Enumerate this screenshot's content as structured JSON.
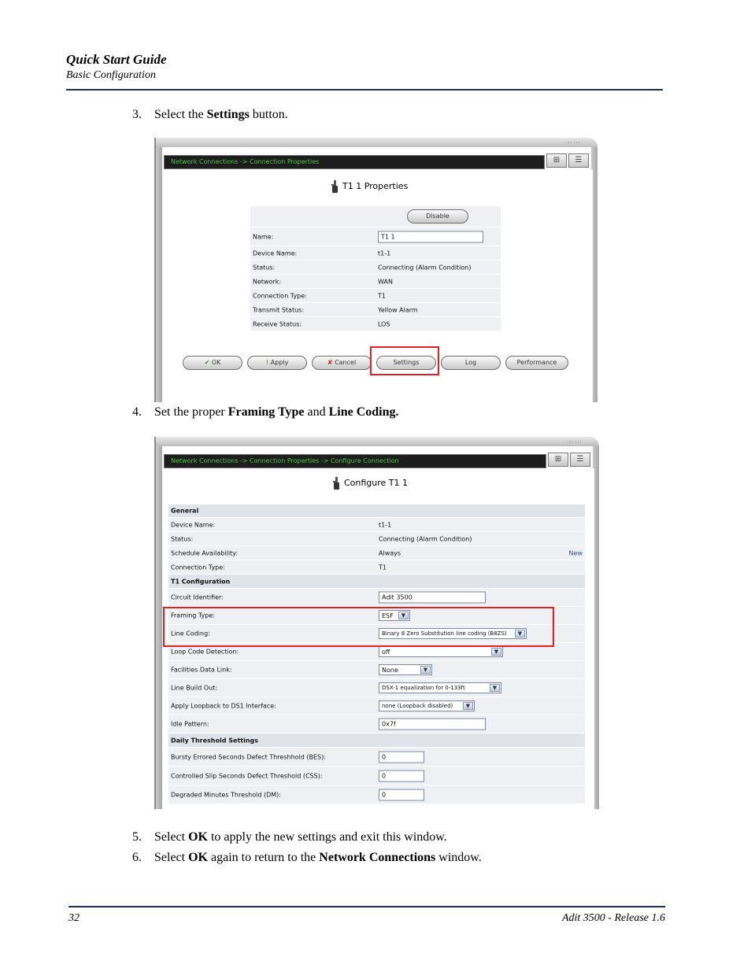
{
  "header": {
    "title": "Quick Start Guide",
    "subtitle": "Basic Configuration"
  },
  "steps": {
    "s3": {
      "num": "3.",
      "pre": "Select the ",
      "bold": "Settings",
      "post": " button."
    },
    "s4": {
      "num": "4.",
      "pre": "Set the proper ",
      "bold1": "Framing Type",
      "mid": " and ",
      "bold2": "Line Coding."
    },
    "s5": {
      "num": "5.",
      "pre": "Select ",
      "bold": "OK",
      "post": " to apply the new settings and exit this window."
    },
    "s6": {
      "num": "6.",
      "pre": "Select ",
      "bold1": "OK",
      "mid": " again to return to the ",
      "bold2": "Network Connections",
      "post": " window."
    }
  },
  "screen1": {
    "breadcrumb": "Network Connections -> Connection Properties",
    "title": "T1 1 Properties",
    "disable_label": "Disable",
    "rows": [
      {
        "label": "Name:",
        "value": "T1 1"
      },
      {
        "label": "Device Name:",
        "value": "t1-1"
      },
      {
        "label": "Status:",
        "value": "Connecting (Alarm Condition)"
      },
      {
        "label": "Network:",
        "value": "WAN"
      },
      {
        "label": "Connection Type:",
        "value": "T1"
      },
      {
        "label": "Transmit Status:",
        "value": "Yellow Alarm"
      },
      {
        "label": "Receive Status:",
        "value": "LOS"
      }
    ],
    "buttons": {
      "ok_icon": "✔",
      "ok": "OK",
      "apply_icon": "!",
      "apply": "Apply",
      "cancel_icon": "✘",
      "cancel": "Cancel",
      "settings": "Settings",
      "log": "Log",
      "performance": "Performance"
    }
  },
  "screen2": {
    "breadcrumb": "Network Connections -> Connection Properties -> Configure Connection",
    "title": "Configure T1 1",
    "general": {
      "header": "General",
      "rows": [
        {
          "label": "Device Name:",
          "value": "t1-1"
        },
        {
          "label": "Status:",
          "value": "Connecting (Alarm Condition)"
        },
        {
          "label": "Schedule Availability:",
          "value": "Always",
          "link": "New"
        },
        {
          "label": "Connection Type:",
          "value": "T1"
        }
      ]
    },
    "t1": {
      "header": "T1 Configuration",
      "circuit_label": "Circuit Identifier:",
      "circuit_value": "Adit 3500",
      "framing_label": "Framing Type:",
      "framing_value": "ESF",
      "coding_label": "Line Coding:",
      "coding_value": "Binary 8 Zero Substitution line coding (B8ZS)",
      "loop_label": "Loop Code Detection:",
      "loop_value": "off",
      "fdl_label": "Facilities Data Link:",
      "fdl_value": "None",
      "lbo_label": "Line Build Out:",
      "lbo_value": "DSX-1 equalization for 0-133ft",
      "loopback_label": "Apply Loopback to DS1 Interface:",
      "loopback_value": "none (Loopback disabled)",
      "idle_label": "Idle Pattern:",
      "idle_value": "0x7f"
    },
    "thresholds": {
      "header": "Daily Threshold Settings",
      "bes_label": "Bursty Errored Seconds Defect Threshhold (BES):",
      "bes_value": "0",
      "css_label": "Controlled Slip Seconds Defect Threshold (CSS):",
      "css_value": "0",
      "dm_label": "Degraded Minutes Threshold (DM):",
      "dm_value": "0"
    }
  },
  "footer": {
    "page": "32",
    "product": "Adit 3500  - Release 1.6"
  }
}
